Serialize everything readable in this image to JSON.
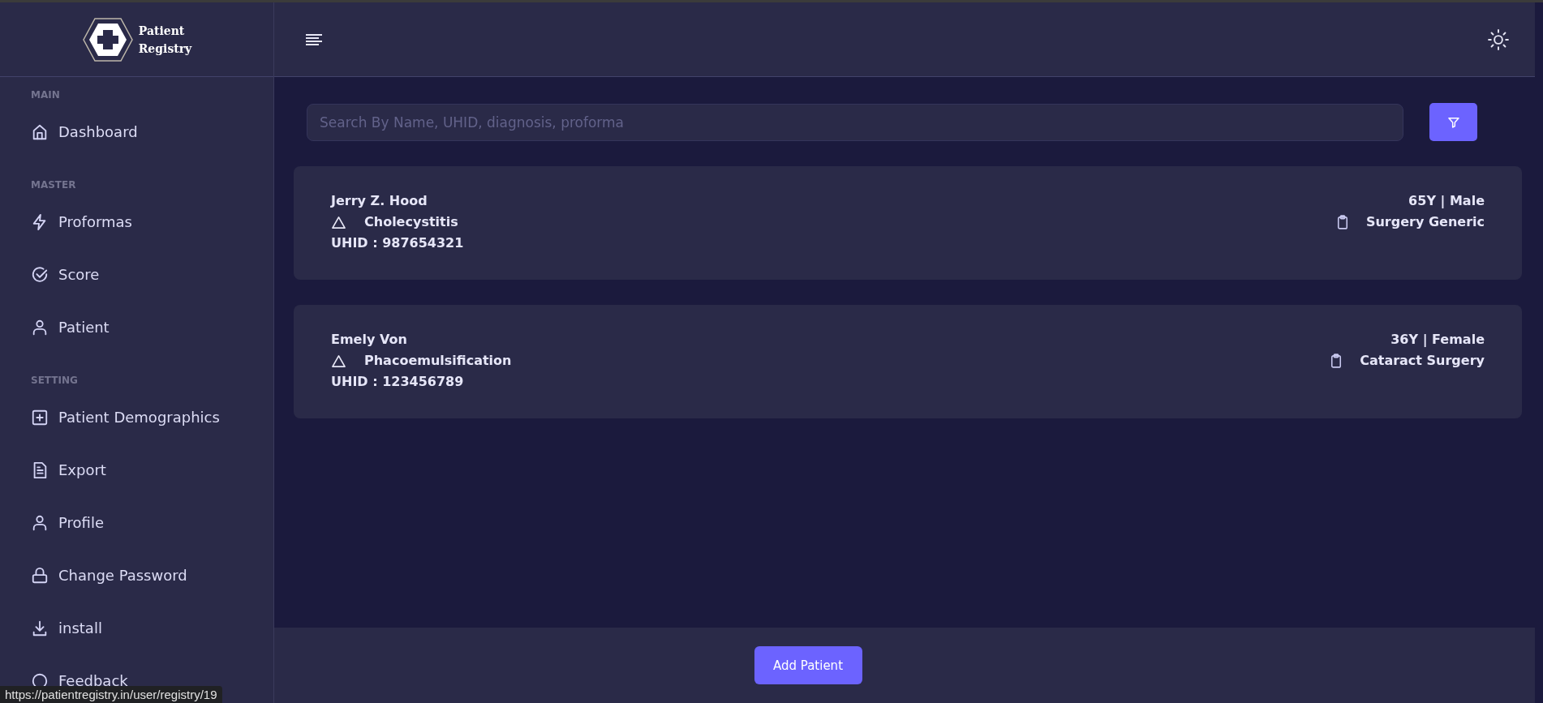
{
  "brand": {
    "lines": [
      "Patient",
      "Registry"
    ]
  },
  "sidebar": {
    "sections": [
      {
        "label": "MAIN",
        "items": [
          {
            "label": "Dashboard",
            "kind": "home"
          }
        ]
      },
      {
        "label": "MASTER",
        "items": [
          {
            "label": "Proformas",
            "kind": "bolt"
          },
          {
            "label": "Score",
            "kind": "check"
          },
          {
            "label": "Patient",
            "kind": "user"
          }
        ]
      },
      {
        "label": "SETTING",
        "items": [
          {
            "label": "Patient Demographics",
            "kind": "plus"
          },
          {
            "label": "Export",
            "kind": "file"
          },
          {
            "label": "Profile",
            "kind": "user"
          },
          {
            "label": "Change Password",
            "kind": "lock"
          },
          {
            "label": "install",
            "kind": "download"
          },
          {
            "label": "Feedback",
            "kind": "chat"
          }
        ]
      }
    ]
  },
  "search": {
    "placeholder": "Search By Name, UHID, diagnosis, proforma"
  },
  "patients": [
    {
      "name": "Jerry Z. Hood",
      "diagnosis": "Cholecystitis",
      "uhid": "UHID : 987654321",
      "age_gender": "65Y | Male",
      "proforma": "Surgery Generic"
    },
    {
      "name": "Emely Von",
      "diagnosis": "Phacoemulsification",
      "uhid": "UHID : 123456789",
      "age_gender": "36Y | Female",
      "proforma": "Cataract Surgery"
    }
  ],
  "add_button": "Add Patient",
  "status_url": "https://patientregistry.in/user/registry/19"
}
